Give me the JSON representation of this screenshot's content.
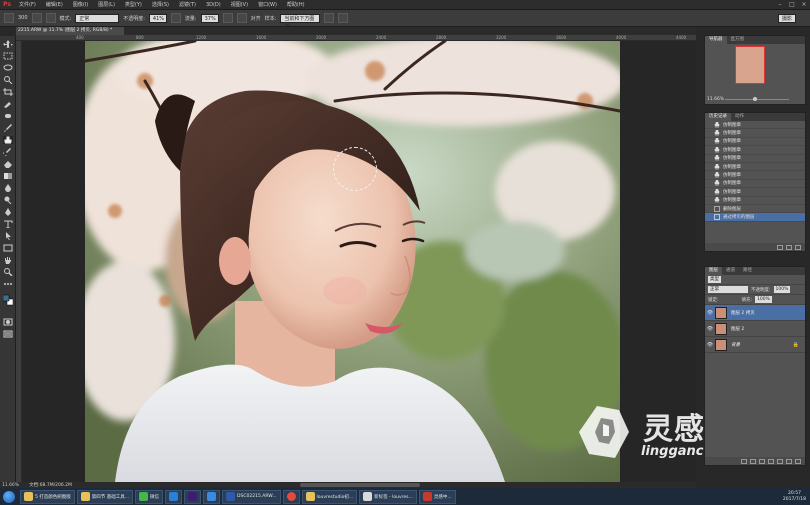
{
  "menubar": {
    "logo": "Ps",
    "items": [
      "文件(F)",
      "编辑(E)",
      "图像(I)",
      "图层(L)",
      "类型(Y)",
      "选择(S)",
      "滤镜(T)",
      "3D(D)",
      "视图(V)",
      "窗口(W)",
      "帮助(H)"
    ],
    "controls": [
      "–",
      "□",
      "×"
    ]
  },
  "options": {
    "brush_size": "300",
    "mode_label": "模式:",
    "mode_value": "正常",
    "opacity_label": "不透明度:",
    "opacity_value": "41%",
    "flow_label": "流量:",
    "flow_value": "37%",
    "aligned_label": "对齐",
    "sample_label": "样本:",
    "sample_value": "当前和下方图层",
    "workspace": "摄影"
  },
  "document": {
    "tab_title": "2215.ARW @ 11.7% (图层 2 拷贝, RGB/8) *",
    "ruler_ticks": [
      "400",
      "800",
      "1200",
      "1600",
      "2000",
      "2400",
      "2800",
      "3200",
      "3600",
      "4000",
      "4400"
    ]
  },
  "navigator": {
    "tabs": [
      "导航器",
      "直方图"
    ],
    "zoom": "11.66%"
  },
  "history": {
    "tabs": [
      "历史记录",
      "动作"
    ],
    "items": [
      "仿制图章",
      "仿制图章",
      "仿制图章",
      "仿制图章",
      "仿制图章",
      "仿制图章",
      "仿制图章",
      "仿制图章",
      "仿制图章",
      "仿制图章",
      "删除图层",
      "通过拷贝的图层"
    ]
  },
  "layers": {
    "tabs": [
      "图层",
      "通道",
      "路径"
    ],
    "kind_label": "类型",
    "blend_mode": "正常",
    "opacity_label": "不透明度:",
    "opacity_value": "100%",
    "lock_label": "锁定:",
    "fill_label": "填充:",
    "fill_value": "100%",
    "items": [
      {
        "name": "图层 2 拷贝",
        "selected": true
      },
      {
        "name": "图层 2",
        "selected": false
      },
      {
        "name": "背景",
        "selected": false,
        "locked": true
      }
    ]
  },
  "status": {
    "zoom": "11.66%",
    "doc_size": "文档:68.7M/206.2M"
  },
  "watermark": {
    "brand_cn": "灵感中国",
    "url": "lingganchina.com"
  },
  "taskbar": {
    "items": [
      {
        "label": "5 打造颜色刷图版",
        "color": "#e7c15a"
      },
      {
        "label": "第四节 基础工具...",
        "color": "#e7c15a"
      },
      {
        "label": "微信",
        "color": "#46b64a"
      },
      {
        "label": "",
        "color": "#2a7fd6"
      },
      {
        "label": "",
        "color": "#3b1f6e"
      },
      {
        "label": "",
        "color": "#3a8be0"
      },
      {
        "label": "DSC02215.ARW...",
        "color": "#2e5aa8"
      },
      {
        "label": "",
        "color": "#e4493c"
      },
      {
        "label": "louvrestudio初...",
        "color": "#e7c15a"
      },
      {
        "label": "新标签 - louvres...",
        "color": "#d9d9d9"
      },
      {
        "label": "灵感中...",
        "color": "#c83a2e"
      }
    ],
    "time": "20:57",
    "date": "2017/7/18"
  },
  "colors": {
    "accent": "#4a6fa5",
    "panel": "#535353",
    "watermark_icon": "#ffffff"
  }
}
